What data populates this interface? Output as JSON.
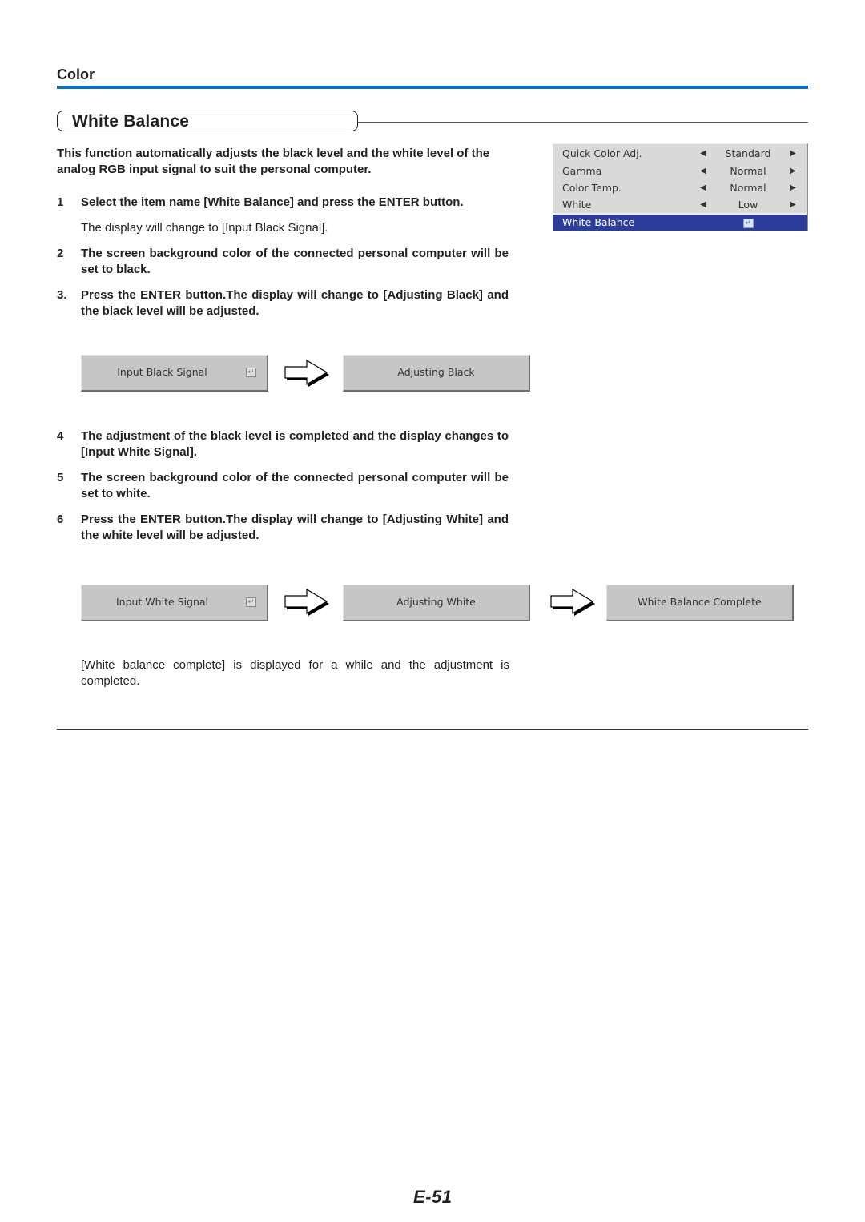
{
  "section": {
    "title": "Color",
    "accent_color": "#0a72c0"
  },
  "heading": "White Balance",
  "intro": "This function automatically adjusts the black level and the white level of the analog RGB input signal to suit the personal computer.",
  "steps": [
    {
      "num": "1",
      "text": "Select the item name [White Balance] and press the ENTER button.",
      "note": "The display will change to [Input Black Signal]."
    },
    {
      "num": "2",
      "text": "The screen background color of the connected personal computer will be set to black."
    },
    {
      "num": "3.",
      "text": "Press the ENTER button.The display will change to [Adjusting Black] and the black level will be adjusted."
    },
    {
      "num": "4",
      "text": "The adjustment of the black level is completed and the display changes to [Input White Signal]."
    },
    {
      "num": "5",
      "text": "The screen background color of the connected personal computer will be set to white."
    },
    {
      "num": "6",
      "text": "Press the ENTER button.The display will change to [Adjusting White] and the white level will be adjusted."
    }
  ],
  "osd_menu": {
    "rows": [
      {
        "label": "Quick Color Adj.",
        "value": "Standard",
        "left_arrow": "◀",
        "right_arrow": "▶"
      },
      {
        "label": "Gamma",
        "value": "Normal",
        "left_arrow": "◀",
        "right_arrow": "▶"
      },
      {
        "label": "Color Temp.",
        "value": "Normal",
        "left_arrow": "◀",
        "right_arrow": "▶"
      },
      {
        "label": "White",
        "value": "Low",
        "left_arrow": "◀",
        "right_arrow": "▶"
      }
    ],
    "selected": {
      "label": "White Balance",
      "icon": "enter-icon",
      "glyph": "↵"
    },
    "highlight_color": "#2c3c9a"
  },
  "flow_black": [
    {
      "label": "Input Black Signal",
      "has_enter": true
    },
    {
      "label": "Adjusting Black",
      "has_enter": false
    }
  ],
  "flow_white": [
    {
      "label": "Input White Signal",
      "has_enter": true
    },
    {
      "label": "Adjusting White",
      "has_enter": false
    },
    {
      "label": "White Balance Complete",
      "has_enter": false
    }
  ],
  "enter_glyph": "↵",
  "closing_note": "[White balance complete] is displayed for a while and the adjustment is completed.",
  "page_number": "E-51"
}
